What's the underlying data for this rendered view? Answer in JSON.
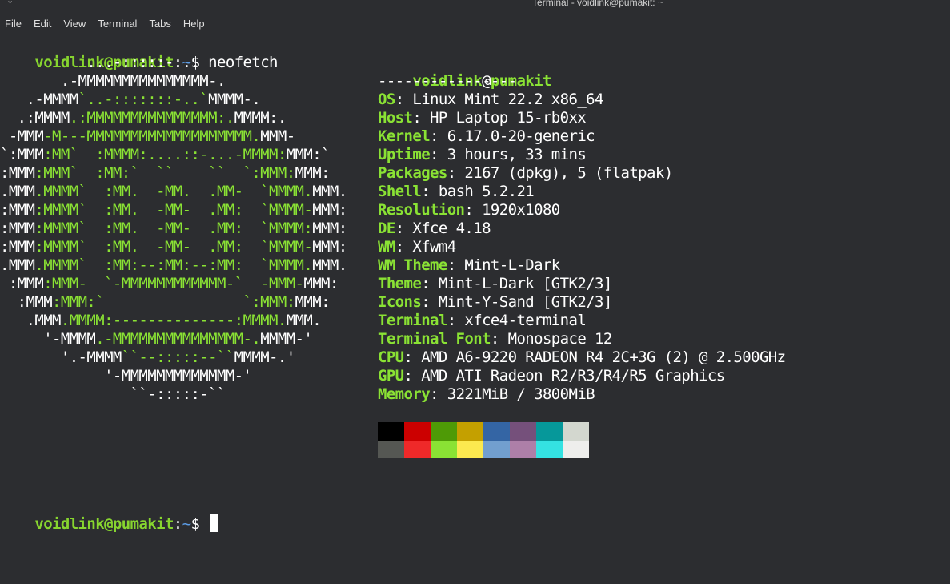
{
  "window": {
    "title": "Terminal - voidlink@pumakit: ~",
    "chevron": "⌄"
  },
  "menu": [
    "File",
    "Edit",
    "View",
    "Terminal",
    "Tabs",
    "Help"
  ],
  "prompt": {
    "user_host": "voidlink@pumakit",
    "sep": ":",
    "path": "~",
    "dollar": "$ ",
    "command": "neofetch"
  },
  "art": [
    [
      [
        "w",
        "          ...-:::::-..."
      ]
    ],
    [
      [
        "w",
        "       .-MMMMMMMMMMMMMMM-."
      ]
    ],
    [
      [
        "w",
        "   .-MMMM"
      ],
      [
        "m",
        "`..-:::::::-..`"
      ],
      [
        "w",
        "MMMM-."
      ]
    ],
    [
      [
        "w",
        "  .:MMMM"
      ],
      [
        "m",
        ".:MMMMMMMMMMMMMMM:."
      ],
      [
        "w",
        "MMMM:."
      ]
    ],
    [
      [
        "w",
        " -MMM"
      ],
      [
        "m",
        "-M---MMMMMMMMMMMMMMMMMMM."
      ],
      [
        "w",
        "MMM-"
      ]
    ],
    [
      [
        "w",
        "`:MMM"
      ],
      [
        "m",
        ":MM`  :MMMM:....::-...-MMMM:"
      ],
      [
        "w",
        "MMM:`"
      ]
    ],
    [
      [
        "w",
        ":MMM"
      ],
      [
        "m",
        ":MMM`  :MM:`  ``    ``  `:MMM:"
      ],
      [
        "w",
        "MMM:"
      ]
    ],
    [
      [
        "w",
        ".MMM"
      ],
      [
        "m",
        ".MMMM`  :MM.  -MM.  .MM-  `MMMM."
      ],
      [
        "w",
        "MMM."
      ]
    ],
    [
      [
        "w",
        ":MMM"
      ],
      [
        "m",
        ":MMMM`  :MM.  -MM-  .MM:  `MMMM-"
      ],
      [
        "w",
        "MMM:"
      ]
    ],
    [
      [
        "w",
        ":MMM"
      ],
      [
        "m",
        ":MMMM`  :MM.  -MM-  .MM:  `MMMM:"
      ],
      [
        "w",
        "MMM:"
      ]
    ],
    [
      [
        "w",
        ":MMM"
      ],
      [
        "m",
        ":MMMM`  :MM.  -MM-  .MM:  `MMMM-"
      ],
      [
        "w",
        "MMM:"
      ]
    ],
    [
      [
        "w",
        ".MMM"
      ],
      [
        "m",
        ".MMMM`  :MM:--:MM:--:MM:  `MMMM."
      ],
      [
        "w",
        "MMM."
      ]
    ],
    [
      [
        "w",
        " :MMM"
      ],
      [
        "m",
        ":MMM-  `-MMMMMMMMMMMM-`  -MMM-"
      ],
      [
        "w",
        "MMM:"
      ]
    ],
    [
      [
        "w",
        "  :MMM"
      ],
      [
        "m",
        ":MMM:`                `:MMM:"
      ],
      [
        "w",
        "MMM:"
      ]
    ],
    [
      [
        "w",
        "   .MMM"
      ],
      [
        "m",
        ".MMMM:--------------:MMMM."
      ],
      [
        "w",
        "MMM."
      ]
    ],
    [
      [
        "w",
        "     '-MMMM"
      ],
      [
        "m",
        ".-MMMMMMMMMMMMMMM-."
      ],
      [
        "w",
        "MMMM-'"
      ]
    ],
    [
      [
        "w",
        "       '.-MMMM"
      ],
      [
        "m",
        "``--:::::--``"
      ],
      [
        "w",
        "MMMM-.'"
      ]
    ],
    [
      [
        "w",
        "            '-MMMMMMMMMMMMM-'"
      ]
    ],
    [
      [
        "w",
        "               ``-:::::-``"
      ]
    ]
  ],
  "info": {
    "header_user": "voidlink",
    "header_at": "@",
    "header_host": "pumakit",
    "underline": "----------------",
    "rows": [
      {
        "key": "OS",
        "value": "Linux Mint 22.2 x86_64"
      },
      {
        "key": "Host",
        "value": "HP Laptop 15-rb0xx"
      },
      {
        "key": "Kernel",
        "value": "6.17.0-20-generic"
      },
      {
        "key": "Uptime",
        "value": "3 hours, 33 mins"
      },
      {
        "key": "Packages",
        "value": "2167 (dpkg), 5 (flatpak)"
      },
      {
        "key": "Shell",
        "value": "bash 5.2.21"
      },
      {
        "key": "Resolution",
        "value": "1920x1080"
      },
      {
        "key": "DE",
        "value": "Xfce 4.18"
      },
      {
        "key": "WM",
        "value": "Xfwm4"
      },
      {
        "key": "WM Theme",
        "value": "Mint-L-Dark"
      },
      {
        "key": "Theme",
        "value": "Mint-L-Dark [GTK2/3]"
      },
      {
        "key": "Icons",
        "value": "Mint-Y-Sand [GTK2/3]"
      },
      {
        "key": "Terminal",
        "value": "xfce4-terminal"
      },
      {
        "key": "Terminal Font",
        "value": "Monospace 12"
      },
      {
        "key": "CPU",
        "value": "AMD A6-9220 RADEON R4 2C+3G (2) @ 2.500GHz"
      },
      {
        "key": "GPU",
        "value": "AMD ATI Radeon R2/R3/R4/R5 Graphics"
      },
      {
        "key": "Memory",
        "value": "3221MiB / 3800MiB"
      }
    ],
    "palette": [
      "#000000",
      "#cc0000",
      "#4e9a06",
      "#c4a000",
      "#3465a4",
      "#75507b",
      "#06989a",
      "#d3d7cf",
      "#555753",
      "#ef2929",
      "#8ae234",
      "#fce94f",
      "#729fcf",
      "#ad7fa8",
      "#34e2e2",
      "#eeeeec"
    ]
  },
  "colors": {
    "background": "#2c2d30",
    "green": "#8ae234",
    "blue": "#5c9ce6",
    "text": "#ffffff"
  }
}
